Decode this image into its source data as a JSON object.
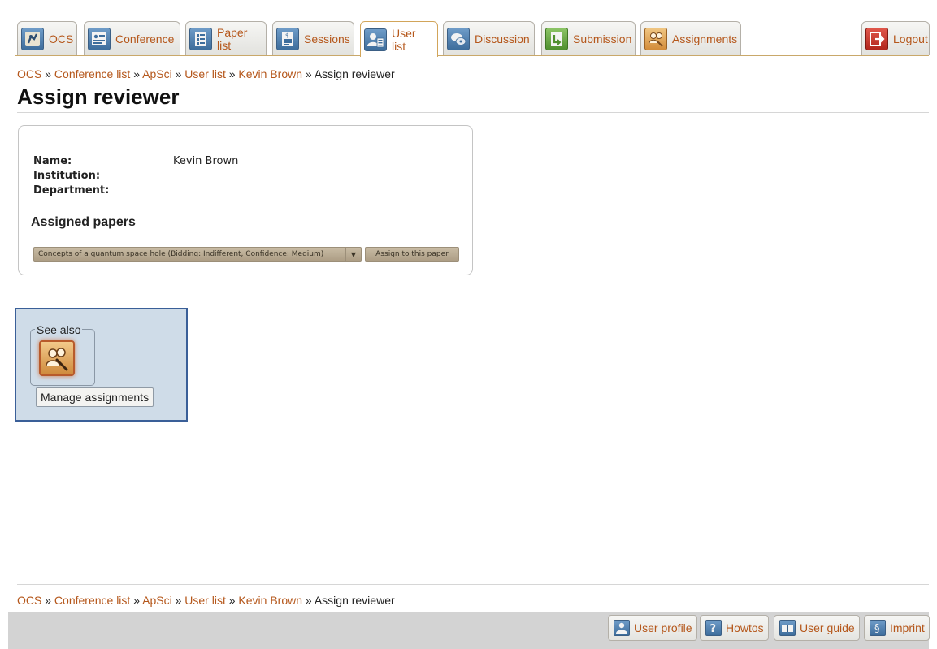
{
  "tabs": [
    {
      "label": "OCS",
      "icon": "ocs-logo-icon"
    },
    {
      "label": "Conference",
      "icon": "conference-icon"
    },
    {
      "label": "Paper list",
      "icon": "paper-list-icon"
    },
    {
      "label": "Sessions",
      "icon": "sessions-icon"
    },
    {
      "label": "User list",
      "icon": "user-list-icon",
      "active": true
    },
    {
      "label": "Discussion",
      "icon": "discussion-icon"
    },
    {
      "label": "Submission",
      "icon": "submission-icon"
    },
    {
      "label": "Assignments",
      "icon": "assignments-icon"
    },
    {
      "label": "Logout",
      "icon": "logout-icon"
    }
  ],
  "breadcrumb": {
    "items": [
      "OCS",
      "Conference list",
      "ApSci",
      "User list",
      "Kevin Brown"
    ],
    "current": "Assign reviewer",
    "separator": "»"
  },
  "page_title": "Assign reviewer",
  "user": {
    "name_label": "Name:",
    "name": "Kevin Brown",
    "institution_label": "Institution:",
    "institution": "",
    "department_label": "Department:",
    "department": ""
  },
  "assigned": {
    "heading": "Assigned papers",
    "selected_paper": "Concepts of a quantum space hole (Bidding: Indifferent, Confidence: Medium)",
    "assign_button": "Assign to this paper"
  },
  "see_also": {
    "legend": "See also",
    "icon": "manage-assignments-icon",
    "tooltip": "Manage assignments"
  },
  "footer_buttons": [
    {
      "label": "User profile",
      "icon": "user-profile-icon"
    },
    {
      "label": "Howtos",
      "icon": "help-icon"
    },
    {
      "label": "User guide",
      "icon": "book-icon"
    },
    {
      "label": "Imprint",
      "icon": "section-icon"
    }
  ],
  "colors": {
    "link": "#b5571b",
    "panel_bg": "#cfdce8",
    "panel_border": "#3a5f98",
    "active_tab_border": "#d2a55a"
  }
}
